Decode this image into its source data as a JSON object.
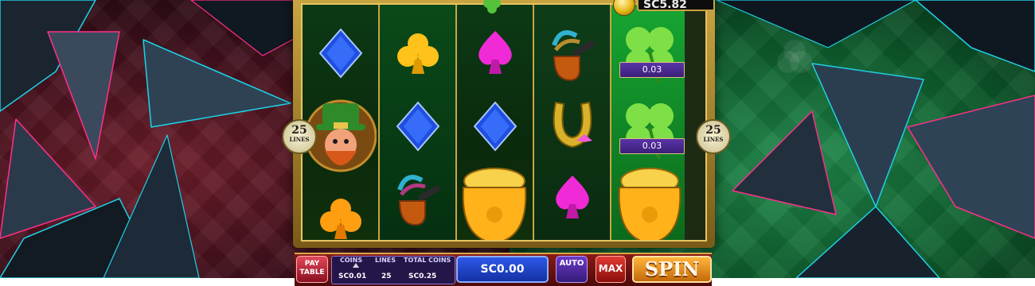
{
  "header": {
    "balance": "SC5.82",
    "coin_icon": "gold-coin-icon"
  },
  "reels": [
    {
      "symbols": [
        "blue-diamond-icon",
        "leprechaun-icon",
        "orange-club-icon"
      ]
    },
    {
      "symbols": [
        "orange-club-icon",
        "blue-diamond-icon",
        "pipe-icon"
      ]
    },
    {
      "symbols": [
        "pink-spade-icon",
        "blue-diamond-icon",
        "pot-of-gold-icon"
      ]
    },
    {
      "symbols": [
        "pipe-icon",
        "horseshoe-icon",
        "pink-spade-icon"
      ]
    },
    {
      "symbols": [
        "clover-icon",
        "clover-icon",
        "pot-of-gold-icon"
      ],
      "values": [
        "0.03",
        "0.03"
      ]
    }
  ],
  "lines_badge": {
    "number": "25",
    "label": "LINES"
  },
  "controls": {
    "pay_table": "PAY TABLE",
    "coins_label": "COINS",
    "coins_value": "SC0.01",
    "lines_label": "LINES",
    "lines_value": "25",
    "total_coins_label": "TOTAL COINS",
    "total_coins_value": "SC0.25",
    "win_value": "SC0.00",
    "auto_label": "AUTO",
    "max_label": "MAX",
    "spin_label": "SPIN"
  },
  "colors": {
    "left_bg": "#3a0f1a",
    "right_bg": "#0d5a2c",
    "frame_gold": "#c9a445",
    "spin_orange": "#e8911a",
    "win_blue": "#2147c8"
  }
}
